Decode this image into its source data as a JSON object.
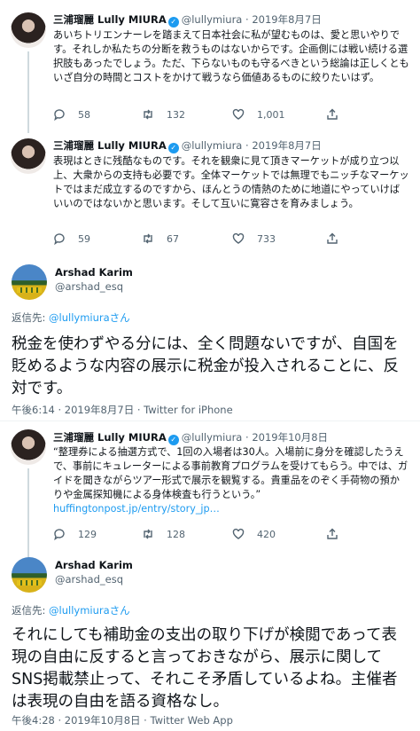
{
  "tweets": [
    {
      "name": "三浦瑠麗 Lully MIURA",
      "handle": "@lullymiura",
      "date": "2019年8月7日",
      "text": "あいちトリエンナーレを踏まえて日本社会に私が望むものは、愛と思いやりです。それしか私たちの分断を救うものはないからです。企画側には戦い続ける選択肢もあったでしょう。ただ、下らないものも守るべきという総論は正しくともいざ自分の時間とコストをかけて戦うなら価値あるものに絞りたいはず。",
      "replies": "58",
      "retweets": "132",
      "likes": "1,001"
    },
    {
      "name": "三浦瑠麗 Lully MIURA",
      "handle": "@lullymiura",
      "date": "2019年8月7日",
      "text": "表現はときに残酷なものです。それを観衆に見て頂きマーケットが成り立つ以上、大衆からの支持も必要です。全体マーケットでは無理でもニッチなマーケットではまだ成立するのですから、ほんとうの情熱のために地道にやっていけばいいのではないかと思います。そして互いに寛容さを育みましょう。",
      "replies": "59",
      "retweets": "67",
      "likes": "733"
    },
    {
      "name": "三浦瑠麗 Lully MIURA",
      "handle": "@lullymiura",
      "date": "2019年10月8日",
      "text": "“整理券による抽選方式で、1回の入場者は30人。入場前に身分を確認したうえで、事前にキュレーターによる事前教育プログラムを受けてもらう。中では、ガイドを聞きながらツアー形式で展示を観覧する。貴重品をのぞく手荷物の預かりや金属探知機による身体検査も行うという。”",
      "link": "huffingtonpost.jp/entry/story_jp…",
      "replies": "129",
      "retweets": "128",
      "likes": "420"
    }
  ],
  "focused": [
    {
      "name": "Arshad Karim",
      "handle": "@arshad_esq",
      "reply_prefix": "返信先: ",
      "reply_handle": "@lullymiuraさん",
      "text": "税金を使わずやる分には、全く問題ないですが、自国を貶めるような内容の展示に税金が投入されることに、反対です。",
      "timestamp": "午後6:14 · 2019年8月7日 · Twitter for iPhone"
    },
    {
      "name": "Arshad Karim",
      "handle": "@arshad_esq",
      "reply_prefix": "返信先: ",
      "reply_handle": "@lullymiuraさん",
      "text": "それにしても補助金の支出の取り下げが検閲であって表現の自由に反すると言っておきながら、展示に関してSNS掲載禁止って、それこそ矛盾しているよね。主催者は表現の自由を語る資格なし。",
      "timestamp": "午後4:28 · 2019年10月8日 · Twitter Web App"
    }
  ],
  "icons": {
    "verified": "✓",
    "reply": "reply-icon",
    "retweet": "retweet-icon",
    "like": "heart-icon",
    "share": "share-icon"
  },
  "colors": {
    "accent": "#1d9bf0",
    "text": "#0f1419",
    "secondary": "#536471"
  }
}
